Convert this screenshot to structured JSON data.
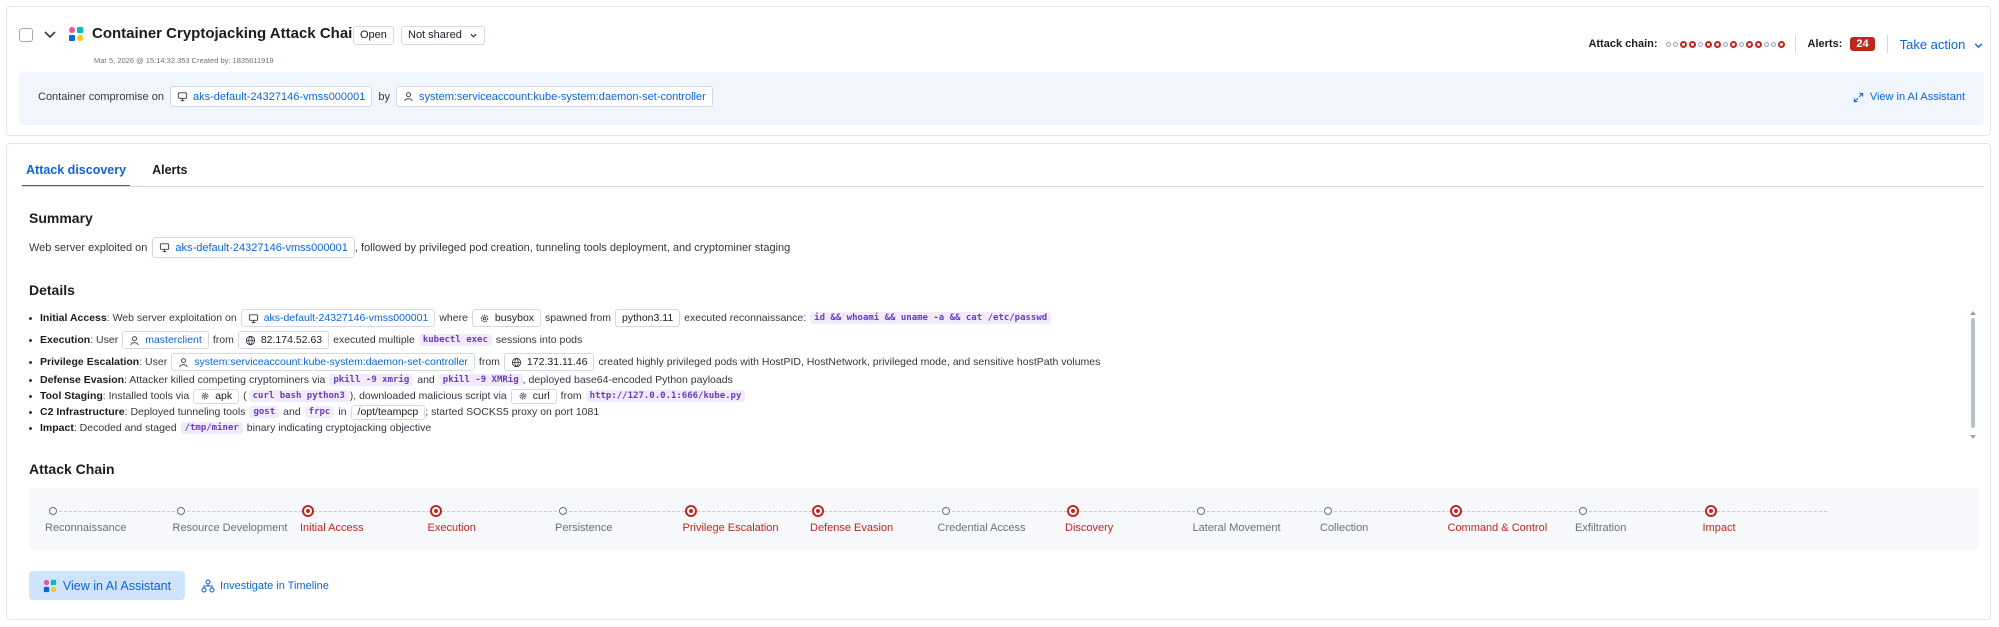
{
  "header": {
    "title": "Container Cryptojacking Attack Chain",
    "status": "Open",
    "sharing": "Not shared",
    "meta": "Mar 5, 2026 @ 15:14:32.353   Created by: 1835611919",
    "attack_chain_label": "Attack chain:",
    "attack_chain_pattern": [
      false,
      false,
      true,
      true,
      false,
      true,
      true,
      false,
      true,
      false,
      true,
      true,
      false,
      false,
      true
    ],
    "alerts_label": "Alerts:",
    "alerts_count": "24",
    "take_action": "Take action"
  },
  "band": {
    "prefix": "Container compromise on",
    "host": "aks-default-24327146-vmss000001",
    "by": "by",
    "user": "system:serviceaccount:kube-system:daemon-set-controller",
    "view_ai": "View in AI Assistant"
  },
  "tabs": [
    "Attack discovery",
    "Alerts"
  ],
  "summary": {
    "heading": "Summary",
    "prefix": "Web server exploited on",
    "host": "aks-default-24327146-vmss000001",
    "suffix": ", followed by privileged pod creation, tunneling tools deployment, and cryptominer staging"
  },
  "details": {
    "heading": "Details",
    "initial_access": {
      "label": "Initial Access",
      "t1": ": Web server exploitation on",
      "host": "aks-default-24327146-vmss000001",
      "t2": "where",
      "proc": "busybox",
      "t3": "spawned from",
      "parent": "python3.11",
      "t4": "executed reconnaissance:",
      "cmd": "id && whoami && uname -a && cat /etc/passwd"
    },
    "execution": {
      "label": "Execution",
      "t1": ": User",
      "user": "masterclient",
      "t2": "from",
      "ip": "82.174.52.63",
      "t3": "executed multiple",
      "cmd": "kubectl exec",
      "t4": "sessions into pods"
    },
    "privilege_escalation": {
      "label": "Privilege Escalation",
      "t1": ": User",
      "user": "system:serviceaccount:kube-system:daemon-set-controller",
      "t2": "from",
      "ip": "172.31.11.46",
      "t3": "created highly privileged pods with HostPID, HostNetwork, privileged mode, and sensitive hostPath volumes"
    },
    "defense_evasion": {
      "label": "Defense Evasion",
      "t1": ": Attacker killed competing cryptominers via",
      "cmd1": "pkill -9 xmrig",
      "t2": "and",
      "cmd2": "pkill -9 XMRig",
      "t3": ", deployed base64-encoded Python payloads"
    },
    "tool_staging": {
      "label": "Tool Staging",
      "t1": ": Installed tools via",
      "proc1": "apk",
      "cmd": "curl bash python3",
      "t2": "), downloaded malicious script via",
      "proc2": "curl",
      "t3": "from",
      "url": "http://127.0.0.1:666/kube.py"
    },
    "c2": {
      "label": "C2 Infrastructure",
      "t1": ": Deployed tunneling tools",
      "tool1": "gost",
      "t2": "and",
      "tool2": "frpc",
      "t3": "in",
      "path": "/opt/teampcp",
      "t4": "; started SOCKS5 proxy on port 1081"
    },
    "impact": {
      "label": "Impact",
      "t1": ": Decoded and staged",
      "path": "/tmp/miner",
      "t2": "binary indicating cryptojacking objective"
    }
  },
  "attack_chain": {
    "heading": "Attack Chain",
    "steps": [
      {
        "label": "Reconnaissance",
        "active": false
      },
      {
        "label": "Resource Development",
        "active": false
      },
      {
        "label": "Initial Access",
        "active": true
      },
      {
        "label": "Execution",
        "active": true
      },
      {
        "label": "Persistence",
        "active": false
      },
      {
        "label": "Privilege Escalation",
        "active": true
      },
      {
        "label": "Defense Evasion",
        "active": true
      },
      {
        "label": "Credential Access",
        "active": false
      },
      {
        "label": "Discovery",
        "active": true
      },
      {
        "label": "Lateral Movement",
        "active": false
      },
      {
        "label": "Collection",
        "active": false
      },
      {
        "label": "Command & Control",
        "active": true
      },
      {
        "label": "Exfiltration",
        "active": false
      },
      {
        "label": "Impact",
        "active": true
      }
    ]
  },
  "actions": {
    "view_ai": "View in AI Assistant",
    "investigate": "Investigate in Timeline"
  },
  "colors": {
    "accent": "#0b64dd",
    "danger": "#bd271e",
    "band_bg": "#f1f6fd",
    "code_bg": "#f1ecfb"
  }
}
